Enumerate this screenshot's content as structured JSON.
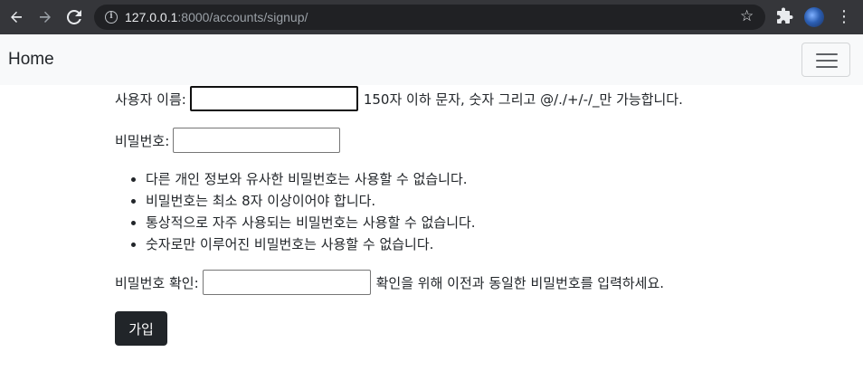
{
  "browser": {
    "url_host": "127.0.0.1",
    "url_path": ":8000/accounts/signup/"
  },
  "navbar": {
    "brand": "Home"
  },
  "form": {
    "username": {
      "label": "사용자 이름:",
      "help": "150자 이하 문자, 숫자 그리고 @/./+/-/_만 가능합니다.",
      "value": ""
    },
    "password": {
      "label": "비밀번호:",
      "value": "",
      "rules": [
        "다른 개인 정보와 유사한 비밀번호는 사용할 수 없습니다.",
        "비밀번호는 최소 8자 이상이어야 합니다.",
        "통상적으로 자주 사용되는 비밀번호는 사용할 수 없습니다.",
        "숫자로만 이루어진 비밀번호는 사용할 수 없습니다."
      ]
    },
    "password_confirm": {
      "label": "비밀번호 확인:",
      "help": "확인을 위해 이전과 동일한 비밀번호를 입력하세요.",
      "value": ""
    },
    "submit_label": "가입"
  }
}
